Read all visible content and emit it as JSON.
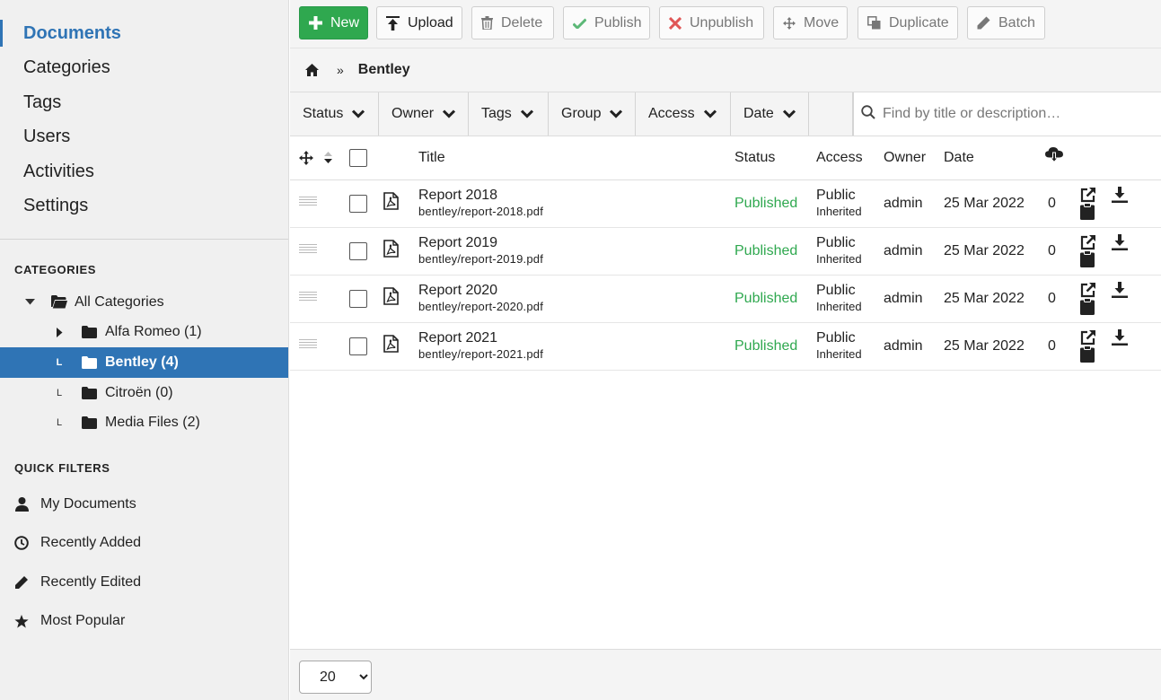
{
  "sidebar": {
    "nav": [
      {
        "label": "Documents",
        "active": true
      },
      {
        "label": "Categories"
      },
      {
        "label": "Tags"
      },
      {
        "label": "Users"
      },
      {
        "label": "Activities"
      },
      {
        "label": "Settings"
      }
    ],
    "categories_heading": "CATEGORIES",
    "categories": [
      {
        "label": "All Categories"
      },
      {
        "label": "Alfa Romeo (1)"
      },
      {
        "label": "Bentley (4)",
        "selected": true
      },
      {
        "label": "Citroën (0)"
      },
      {
        "label": "Media Files (2)"
      }
    ],
    "quick_filters_heading": "QUICK FILTERS",
    "quick_filters": [
      {
        "label": "My Documents",
        "icon": "user-icon"
      },
      {
        "label": "Recently Added",
        "icon": "clock-icon"
      },
      {
        "label": "Recently Edited",
        "icon": "pencil-icon"
      },
      {
        "label": "Most Popular",
        "icon": "star-icon"
      }
    ]
  },
  "toolbar": {
    "new": "New",
    "upload": "Upload",
    "delete": "Delete",
    "publish": "Publish",
    "unpublish": "Unpublish",
    "move": "Move",
    "duplicate": "Duplicate",
    "batch": "Batch"
  },
  "breadcrumb": {
    "separator": "»",
    "current": "Bentley"
  },
  "filters": {
    "status": "Status",
    "owner": "Owner",
    "tags": "Tags",
    "group": "Group",
    "access": "Access",
    "date": "Date",
    "search_placeholder": "Find by title or description…"
  },
  "table": {
    "headers": {
      "title": "Title",
      "status": "Status",
      "access": "Access",
      "owner": "Owner",
      "date": "Date"
    },
    "rows": [
      {
        "title": "Report 2018",
        "file": "bentley/report-2018.pdf",
        "status": "Published",
        "access": "Public",
        "access_sub": "Inherited",
        "owner": "admin",
        "date": "25 Mar 2022",
        "downloads": "0"
      },
      {
        "title": "Report 2019",
        "file": "bentley/report-2019.pdf",
        "status": "Published",
        "access": "Public",
        "access_sub": "Inherited",
        "owner": "admin",
        "date": "25 Mar 2022",
        "downloads": "0"
      },
      {
        "title": "Report 2020",
        "file": "bentley/report-2020.pdf",
        "status": "Published",
        "access": "Public",
        "access_sub": "Inherited",
        "owner": "admin",
        "date": "25 Mar 2022",
        "downloads": "0"
      },
      {
        "title": "Report 2021",
        "file": "bentley/report-2021.pdf",
        "status": "Published",
        "access": "Public",
        "access_sub": "Inherited",
        "owner": "admin",
        "date": "25 Mar 2022",
        "downloads": "0"
      }
    ]
  },
  "footer": {
    "per_page": "20"
  },
  "colors": {
    "accent": "#2f74b5",
    "success": "#2fa84f",
    "danger": "#e05656"
  }
}
